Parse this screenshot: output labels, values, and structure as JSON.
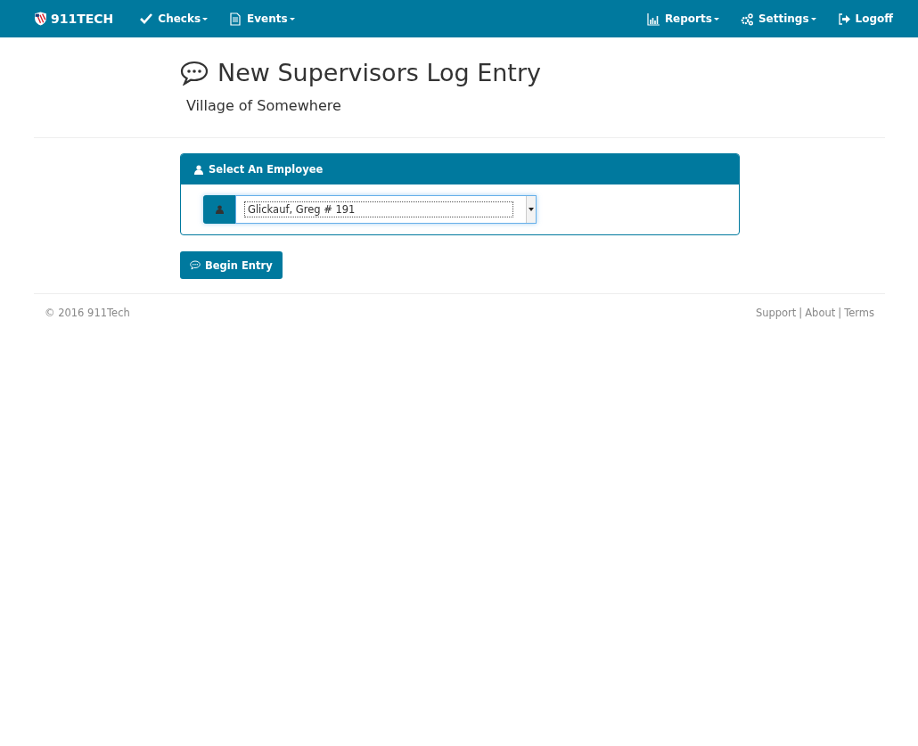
{
  "navbar": {
    "brand": "911TECH",
    "left_items": [
      {
        "label": "Checks",
        "kind": "check",
        "dropdown": true
      },
      {
        "label": "Events",
        "kind": "document",
        "dropdown": true
      }
    ],
    "right_items": [
      {
        "label": "Reports",
        "kind": "chart",
        "dropdown": true
      },
      {
        "label": "Settings",
        "kind": "gears",
        "dropdown": true
      },
      {
        "label": "Logoff",
        "kind": "logout",
        "dropdown": false
      }
    ]
  },
  "header": {
    "title": "New Supervisors Log Entry",
    "subtitle": "Village of Somewhere"
  },
  "panel": {
    "heading": "Select An Employee",
    "select": {
      "value": "Glickauf, Greg # 191"
    }
  },
  "begin_button": "Begin Entry",
  "footer": {
    "copyright": "© 2016  911Tech",
    "links": [
      "Support",
      "About",
      "Terms"
    ],
    "separators": [
      "|",
      "|"
    ]
  }
}
